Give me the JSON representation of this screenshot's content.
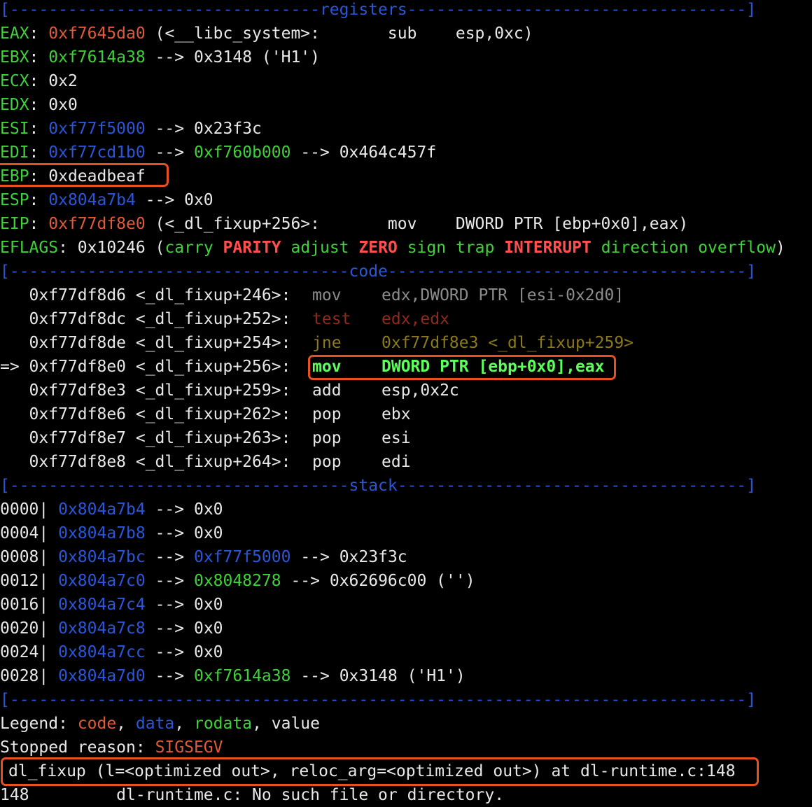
{
  "separators": {
    "registers": "[--------------------------------registers-----------------------------------]",
    "code": "[-----------------------------------code-------------------------------------]",
    "stack": "[-----------------------------------stack------------------------------------]",
    "bottom": "[----------------------------------------------------------------------------]"
  },
  "registers": [
    {
      "name": "EAX",
      "value": "0xf7645da0",
      "rest": " (<__libc_system>:       sub    esp,0xc)"
    },
    {
      "name": "EBX",
      "value": "0xf7614a38",
      "rest": " --> 0x3148 ('H1')"
    },
    {
      "name": "ECX",
      "value": "0x2",
      "rest": ""
    },
    {
      "name": "EDX",
      "value": "0x0",
      "rest": ""
    },
    {
      "name": "ESI",
      "value": "0xf77f5000",
      "rest": " --> 0x23f3c"
    },
    {
      "name": "EDI",
      "value": "0xf77cd1b0",
      "rest_a": " --> ",
      "value2": "0xf760b000",
      "rest_b": " --> 0x464c457f"
    },
    {
      "name": "EBP",
      "value": "0xdeadbeaf",
      "rest": ""
    },
    {
      "name": "ESP",
      "value": "0x804a7b4",
      "rest": " --> 0x0"
    },
    {
      "name": "EIP",
      "value": "0xf77df8e0",
      "rest": " (<_dl_fixup+256>:       mov    DWORD PTR [ebp+0x0],eax)"
    }
  ],
  "eflags": {
    "name": "EFLAGS",
    "value": "0x10246",
    "flags": [
      "carry",
      "PARITY",
      "adjust",
      "ZERO",
      "sign",
      "trap",
      "INTERRUPT",
      "direction",
      "overflow"
    ]
  },
  "code": [
    {
      "prefix": "   ",
      "addr": "0xf77df8d6 <_dl_fixup+246>:",
      "op": "mov",
      "args": "edx,DWORD PTR [esi-0x2d0]"
    },
    {
      "prefix": "   ",
      "addr": "0xf77df8dc <_dl_fixup+252>:",
      "op": "test",
      "args": "edx,edx"
    },
    {
      "prefix": "   ",
      "addr": "0xf77df8de <_dl_fixup+254>:",
      "op": "jne",
      "args": "0xf77df8e3 <_dl_fixup+259>"
    },
    {
      "prefix": "=> ",
      "addr": "0xf77df8e0 <_dl_fixup+256>:",
      "op": "mov",
      "args": "DWORD PTR [ebp+0x0],eax"
    },
    {
      "prefix": "   ",
      "addr": "0xf77df8e3 <_dl_fixup+259>:",
      "op": "add",
      "args": "esp,0x2c"
    },
    {
      "prefix": "   ",
      "addr": "0xf77df8e6 <_dl_fixup+262>:",
      "op": "pop",
      "args": "ebx"
    },
    {
      "prefix": "   ",
      "addr": "0xf77df8e7 <_dl_fixup+263>:",
      "op": "pop",
      "args": "esi"
    },
    {
      "prefix": "   ",
      "addr": "0xf77df8e8 <_dl_fixup+264>:",
      "op": "pop",
      "args": "edi"
    }
  ],
  "stack": [
    {
      "off": "0000|",
      "addr": "0x804a7b4",
      "rest": " --> 0x0"
    },
    {
      "off": "0004|",
      "addr": "0x804a7b8",
      "rest": " --> 0x0"
    },
    {
      "off": "0008|",
      "addr": "0x804a7bc",
      "mid": " --> ",
      "val": "0xf77f5000",
      "tail": " --> 0x23f3c"
    },
    {
      "off": "0012|",
      "addr": "0x804a7c0",
      "mid": " --> ",
      "val": "0x8048278",
      "tail": " --> 0x62696c00 ('')"
    },
    {
      "off": "0016|",
      "addr": "0x804a7c4",
      "rest": " --> 0x0"
    },
    {
      "off": "0020|",
      "addr": "0x804a7c8",
      "rest": " --> 0x0"
    },
    {
      "off": "0024|",
      "addr": "0x804a7cc",
      "rest": " --> 0x0"
    },
    {
      "off": "0028|",
      "addr": "0x804a7d0",
      "mid": " --> ",
      "val": "0xf7614a38",
      "tail": " --> 0x3148 ('H1')"
    }
  ],
  "legend": {
    "label": "Legend: ",
    "code": "code",
    "data": "data",
    "rodata": "rodata",
    "value": "value"
  },
  "stopped": {
    "label": "Stopped reason: ",
    "reason": "SIGSEGV"
  },
  "frame_line": "dl_fixup (l=<optimized out>, reloc_arg=<optimized out>) at dl-runtime.c:148",
  "source_line": "148\t    dl-runtime.c: No such file or directory.",
  "colors": {
    "code": "#e05a3a",
    "data": "#2b56d9",
    "rodata": "#3fd13a",
    "highlight_box": "#e8501f"
  }
}
